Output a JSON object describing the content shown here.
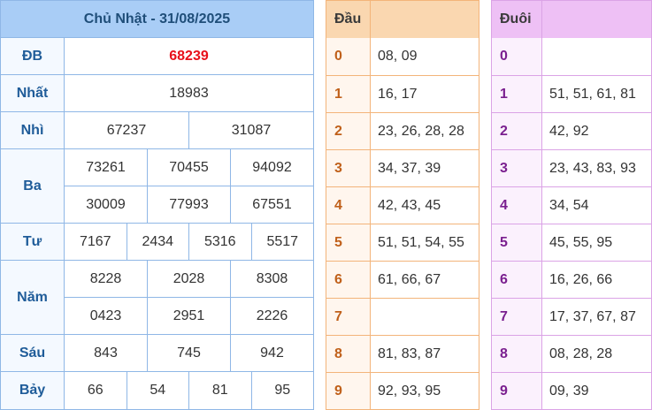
{
  "results": {
    "title": "Chủ Nhật - 31/08/2025",
    "prizes": [
      {
        "label": "ĐB",
        "lines": [
          [
            "68239"
          ]
        ]
      },
      {
        "label": "Nhất",
        "lines": [
          [
            "18983"
          ]
        ]
      },
      {
        "label": "Nhì",
        "lines": [
          [
            "67237",
            "31087"
          ]
        ]
      },
      {
        "label": "Ba",
        "lines": [
          [
            "73261",
            "70455",
            "94092"
          ],
          [
            "30009",
            "77993",
            "67551"
          ]
        ]
      },
      {
        "label": "Tư",
        "lines": [
          [
            "7167",
            "2434",
            "5316",
            "5517"
          ]
        ]
      },
      {
        "label": "Năm",
        "lines": [
          [
            "8228",
            "2028",
            "8308"
          ],
          [
            "0423",
            "2951",
            "2226"
          ]
        ]
      },
      {
        "label": "Sáu",
        "lines": [
          [
            "843",
            "745",
            "942"
          ]
        ]
      },
      {
        "label": "Bảy",
        "lines": [
          [
            "66",
            "54",
            "81",
            "95"
          ]
        ]
      }
    ]
  },
  "dau": {
    "title": "Đầu",
    "rows": [
      {
        "key": "0",
        "value": "08, 09"
      },
      {
        "key": "1",
        "value": "16, 17"
      },
      {
        "key": "2",
        "value": "23, 26, 28, 28"
      },
      {
        "key": "3",
        "value": "34, 37, 39"
      },
      {
        "key": "4",
        "value": "42, 43, 45"
      },
      {
        "key": "5",
        "value": "51, 51, 54, 55"
      },
      {
        "key": "6",
        "value": "61, 66, 67"
      },
      {
        "key": "7",
        "value": ""
      },
      {
        "key": "8",
        "value": "81, 83, 87"
      },
      {
        "key": "9",
        "value": "92, 93, 95"
      }
    ]
  },
  "duoi": {
    "title": "Đuôi",
    "rows": [
      {
        "key": "0",
        "value": ""
      },
      {
        "key": "1",
        "value": "51, 51, 61, 81"
      },
      {
        "key": "2",
        "value": "42, 92"
      },
      {
        "key": "3",
        "value": "23, 43, 83, 93"
      },
      {
        "key": "4",
        "value": "34, 54"
      },
      {
        "key": "5",
        "value": "45, 55, 95"
      },
      {
        "key": "6",
        "value": "16, 26, 66"
      },
      {
        "key": "7",
        "value": "17, 37, 67, 87"
      },
      {
        "key": "8",
        "value": "08, 28, 28"
      },
      {
        "key": "9",
        "value": "09, 39"
      }
    ]
  },
  "colors": {
    "special_prize": "#e8101a",
    "results_header": "#a9cdf6",
    "dau_header": "#fad7b0",
    "duoi_header": "#eec0f5"
  }
}
